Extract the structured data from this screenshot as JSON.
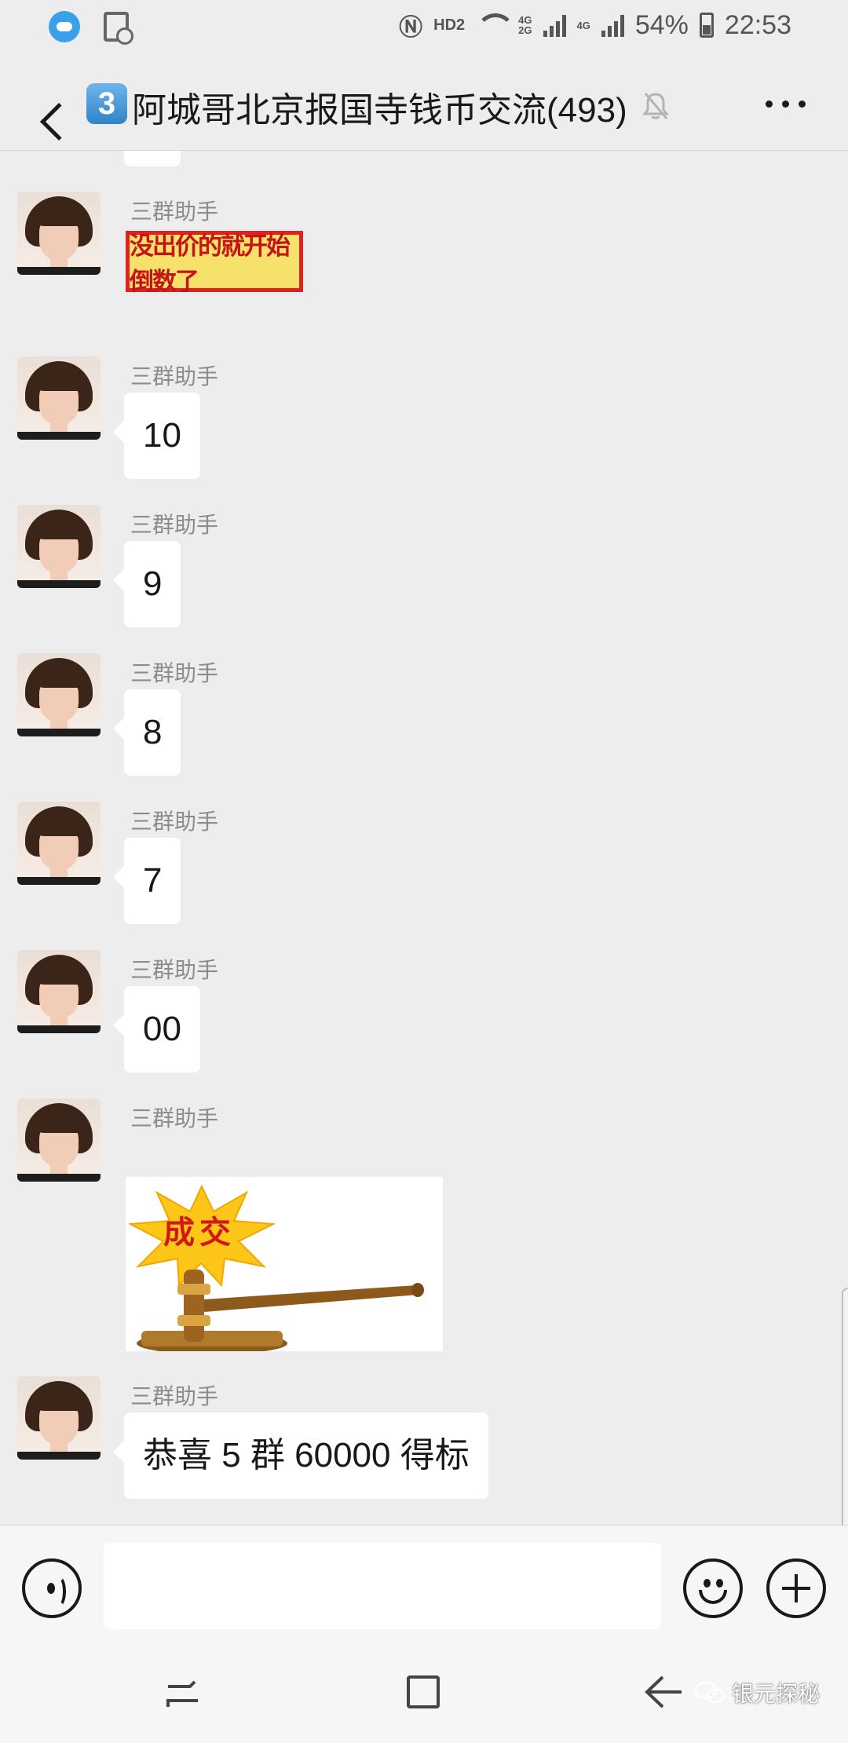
{
  "status_bar": {
    "hd": "HD2",
    "net1": "4G",
    "net2": "2G",
    "net3": "4G",
    "battery": "54%",
    "time": "22:53"
  },
  "header": {
    "badge": "3",
    "title": "阿城哥北京报国寺钱币交流(493)",
    "icons": [
      "back-icon",
      "mute-bell-icon",
      "more-icon"
    ]
  },
  "messages": [
    {
      "sender": "三群助手",
      "type": "sticker",
      "sticker_text": "没出价的就开始倒数了"
    },
    {
      "sender": "三群助手",
      "type": "text",
      "text": "10"
    },
    {
      "sender": "三群助手",
      "type": "text",
      "text": "9"
    },
    {
      "sender": "三群助手",
      "type": "text",
      "text": "8"
    },
    {
      "sender": "三群助手",
      "type": "text",
      "text": "7"
    },
    {
      "sender": "三群助手",
      "type": "text",
      "text": "00"
    },
    {
      "sender": "三群助手",
      "type": "image",
      "image_text": "成交"
    },
    {
      "sender": "三群助手",
      "type": "text",
      "text": "恭喜 5 群 60000 得标"
    }
  ],
  "input_bar": {
    "icons": [
      "voice-icon",
      "emoji-icon",
      "plus-icon"
    ]
  },
  "nav_bar": {
    "icons": [
      "recent-apps-icon",
      "home-icon",
      "back-arrow-icon"
    ],
    "watermark": "银元探秘"
  }
}
